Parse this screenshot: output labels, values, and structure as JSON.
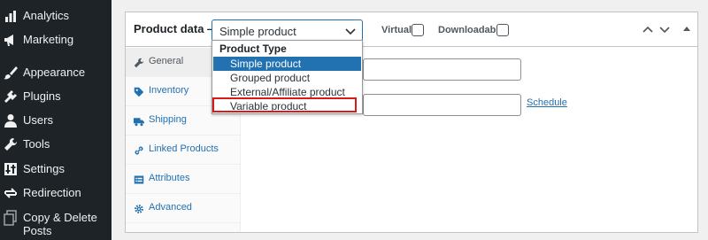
{
  "sidebar": {
    "items": [
      {
        "label": "Analytics",
        "icon": "bar-chart-icon"
      },
      {
        "label": "Marketing",
        "icon": "megaphone-icon"
      },
      {
        "label": "Appearance",
        "icon": "paintbrush-icon"
      },
      {
        "label": "Plugins",
        "icon": "plug-icon"
      },
      {
        "label": "Users",
        "icon": "user-icon"
      },
      {
        "label": "Tools",
        "icon": "wrench-icon"
      },
      {
        "label": "Settings",
        "icon": "sliders-icon"
      },
      {
        "label": "Redirection",
        "icon": "redirect-icon"
      },
      {
        "label": "Copy & Delete\nPosts",
        "icon": "copy-icon"
      }
    ]
  },
  "product_data": {
    "title": "Product data —",
    "type_select_value": "Simple product",
    "virtual_label": "Virtual:",
    "downloadable_label": "Downloadable:"
  },
  "tabs": [
    {
      "label": "General",
      "icon": "wrench-icon"
    },
    {
      "label": "Inventory",
      "icon": "tag-icon"
    },
    {
      "label": "Shipping",
      "icon": "truck-icon"
    },
    {
      "label": "Linked Products",
      "icon": "link-icon"
    },
    {
      "label": "Attributes",
      "icon": "list-icon"
    },
    {
      "label": "Advanced",
      "icon": "gear-icon"
    }
  ],
  "general": {
    "schedule_link": "Schedule"
  },
  "dropdown": {
    "header": "Product Type",
    "options": [
      "Simple product",
      "Grouped product",
      "External/Affiliate product",
      "Variable product"
    ],
    "selected": "Simple product",
    "highlighted": "Variable product"
  },
  "colors": {
    "sidebar_bg": "#1d2327",
    "accent": "#2271b1",
    "highlight_border": "#d71a1a"
  }
}
